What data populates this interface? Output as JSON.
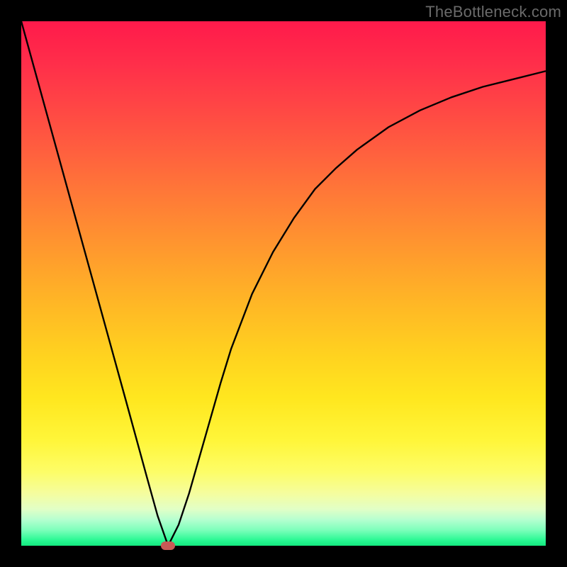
{
  "watermark": "TheBottleneck.com",
  "marker_color": "#c85a56",
  "curve_color": "#000000",
  "chart_data": {
    "type": "line",
    "title": "",
    "xlabel": "",
    "ylabel": "",
    "xlim": [
      0,
      100
    ],
    "ylim": [
      0,
      100
    ],
    "grid": false,
    "series": [
      {
        "name": "bottleneck-curve",
        "x": [
          0,
          4,
          8,
          12,
          16,
          20,
          24,
          26,
          28,
          30,
          32,
          34,
          36,
          38,
          40,
          44,
          48,
          52,
          56,
          60,
          64,
          70,
          76,
          82,
          88,
          94,
          100
        ],
        "y": [
          100,
          85.5,
          71,
          56.5,
          42,
          27.5,
          12.9,
          5.7,
          0,
          4,
          10,
          17,
          24,
          31,
          37.5,
          48,
          56,
          62.5,
          68,
          72,
          75.5,
          79.8,
          83,
          85.5,
          87.5,
          89,
          90.5
        ]
      }
    ],
    "annotations": [
      {
        "name": "min-marker",
        "x": 28,
        "y": 0
      }
    ]
  }
}
